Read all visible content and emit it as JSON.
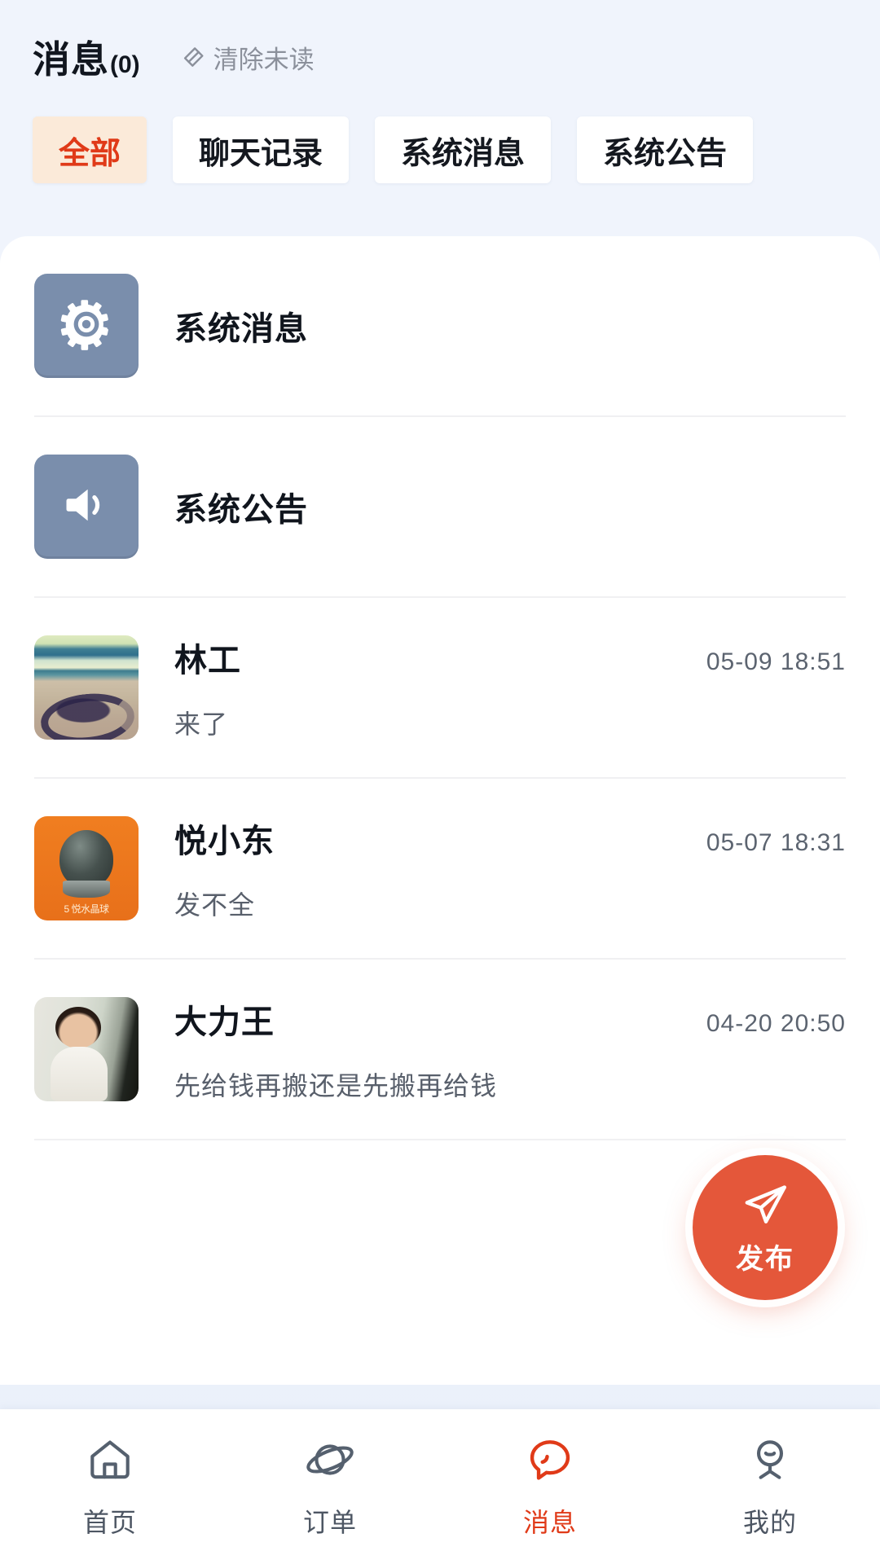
{
  "header": {
    "title": "消息",
    "count": "(0)",
    "clear_unread_label": "清除未读",
    "clear_unread_icon": "eraser-icon"
  },
  "tabs": [
    {
      "label": "全部",
      "active": true
    },
    {
      "label": "聊天记录",
      "active": false
    },
    {
      "label": "系统消息",
      "active": false
    },
    {
      "label": "系统公告",
      "active": false
    }
  ],
  "messages": [
    {
      "name": "系统消息",
      "preview": "",
      "time": "",
      "avatar_type": "system",
      "avatar_icon": "gear-icon"
    },
    {
      "name": "系统公告",
      "preview": "",
      "time": "",
      "avatar_type": "system",
      "avatar_icon": "speaker-icon"
    },
    {
      "name": "林工",
      "preview": "来了",
      "time": "05-09 18:51",
      "avatar_type": "photo-beach",
      "avatar_icon": "avatar-photo"
    },
    {
      "name": "悦小东",
      "preview": "发不全",
      "time": "05-07 18:31",
      "avatar_type": "photo-product",
      "avatar_caption": "5 悦水晶球",
      "avatar_icon": "avatar-photo"
    },
    {
      "name": "大力王",
      "preview": "先给钱再搬还是先搬再给钱",
      "time": "04-20 20:50",
      "avatar_type": "photo-baby",
      "avatar_icon": "avatar-photo"
    }
  ],
  "fab": {
    "label": "发布",
    "icon": "paper-plane-icon"
  },
  "bottom_nav": [
    {
      "label": "首页",
      "icon": "home-icon",
      "active": false
    },
    {
      "label": "订单",
      "icon": "orders-planet-icon",
      "active": false
    },
    {
      "label": "消息",
      "icon": "chat-bubble-icon",
      "active": true
    },
    {
      "label": "我的",
      "icon": "profile-icon",
      "active": false
    }
  ],
  "colors": {
    "accent": "#e03a18",
    "fab": "#e4573a",
    "active_tab_bg": "#fbead9",
    "system_avatar": "#7a8eac",
    "page_bg": "#eff3fb"
  }
}
